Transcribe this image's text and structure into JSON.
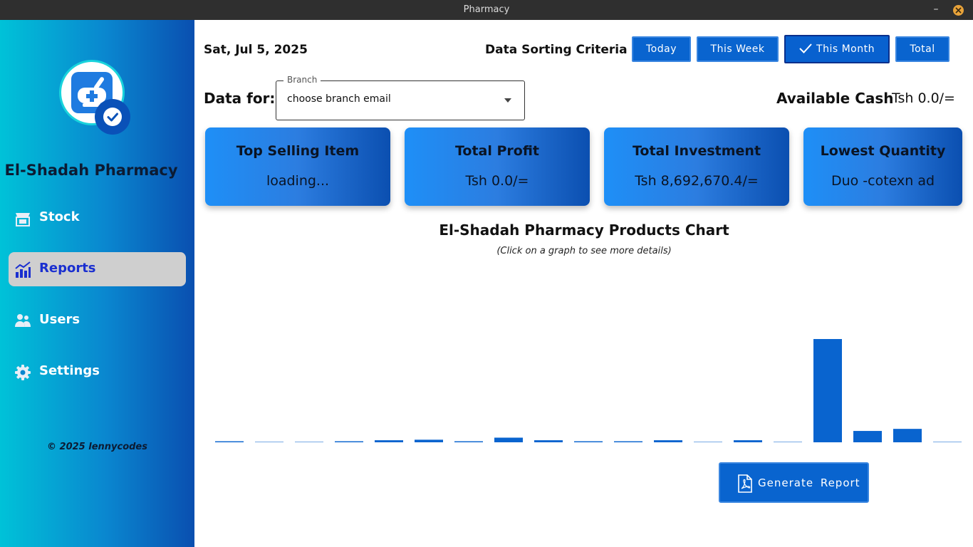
{
  "window": {
    "title": "Pharmacy",
    "minimize_label": "–"
  },
  "sidebar": {
    "brand": "El-Shadah Pharmacy",
    "items": [
      {
        "label": "Stock",
        "icon": "store-icon"
      },
      {
        "label": "Reports",
        "icon": "bar-chart-icon",
        "active": true
      },
      {
        "label": "Users",
        "icon": "users-icon"
      },
      {
        "label": "Settings",
        "icon": "gear-icon"
      }
    ],
    "copyright": "© 2025 lennycodes"
  },
  "header": {
    "date": "Sat, Jul 5, 2025",
    "criteria_label": "Data Sorting Criteria",
    "filters": [
      "Today",
      "This Week",
      "This Month",
      "Total"
    ],
    "selected_filter": "This Month"
  },
  "branch": {
    "label": "Data for:",
    "field_legend": "Branch",
    "value": "choose branch email"
  },
  "cash": {
    "label": "Available Cash",
    "value": "Tsh 0.0/="
  },
  "cards": [
    {
      "title": "Top Selling Item",
      "value": "loading..."
    },
    {
      "title": "Total Profit",
      "value": "Tsh 0.0/="
    },
    {
      "title": "Total Investment",
      "value": "Tsh 8,692,670.4/="
    },
    {
      "title": "Lowest Quantity",
      "value": "Duo -cotexn ad"
    }
  ],
  "chart": {
    "title": "El-Shadah Pharmacy Products Chart",
    "subtitle": "(Click on a graph to see more details)"
  },
  "chart_data": {
    "type": "bar",
    "categories": [],
    "values": [
      1,
      0.5,
      0.5,
      1,
      2,
      2.5,
      1,
      4.5,
      2,
      1,
      1,
      2,
      0.5,
      2,
      0.5,
      100,
      11,
      13,
      0.5
    ],
    "bar_color": "#0964cf",
    "grid": false
  },
  "report_button": {
    "label": "Generate  Report",
    "icon": "pdf-icon"
  },
  "colors": {
    "accent": "#0964cf",
    "sidebar_start": "#00c2d8",
    "sidebar_end": "#0a4fb0"
  }
}
